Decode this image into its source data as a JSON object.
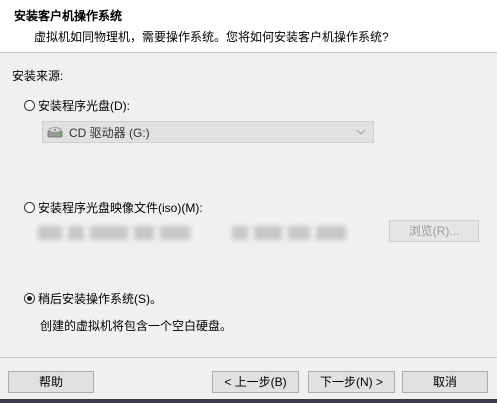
{
  "header": {
    "title": "安装客户机操作系统",
    "subtitle": "虚拟机如同物理机，需要操作系统。您将如何安装客户机操作系统?"
  },
  "install_source": {
    "label": "安装来源:",
    "options": [
      {
        "label": "安装程序光盘(D):",
        "selected": false
      },
      {
        "label": "安装程序光盘映像文件(iso)(M):",
        "selected": false
      },
      {
        "label": "稍后安装操作系统(S)。",
        "selected": true
      }
    ],
    "drive_select": {
      "value": "CD 驱动器 (G:)",
      "icon": "cd-drive-icon"
    },
    "browse_label": "浏览(R)...",
    "later_description": "创建的虚拟机将包含一个空白硬盘。"
  },
  "buttons": {
    "help": "帮助",
    "prev": "< 上一步(B)",
    "next": "下一步(N) >",
    "cancel": "取消"
  }
}
